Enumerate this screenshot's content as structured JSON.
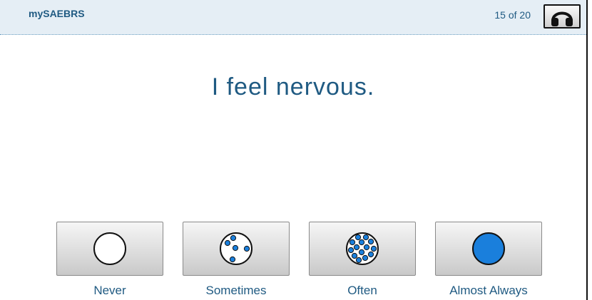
{
  "header": {
    "app_title": "mySAEBRS",
    "progress": "15 of 20",
    "audio_icon": "headphones-icon"
  },
  "question": {
    "text": "I feel nervous."
  },
  "choices": [
    {
      "label": "Never",
      "icon": "empty-circle-icon"
    },
    {
      "label": "Sometimes",
      "icon": "few-dots-circle-icon"
    },
    {
      "label": "Often",
      "icon": "many-dots-circle-icon"
    },
    {
      "label": "Almost Always",
      "icon": "filled-circle-icon"
    }
  ],
  "colors": {
    "accent": "#1f5a82",
    "fill_blue": "#1a7fdc",
    "header_bg": "#e5eef5"
  }
}
